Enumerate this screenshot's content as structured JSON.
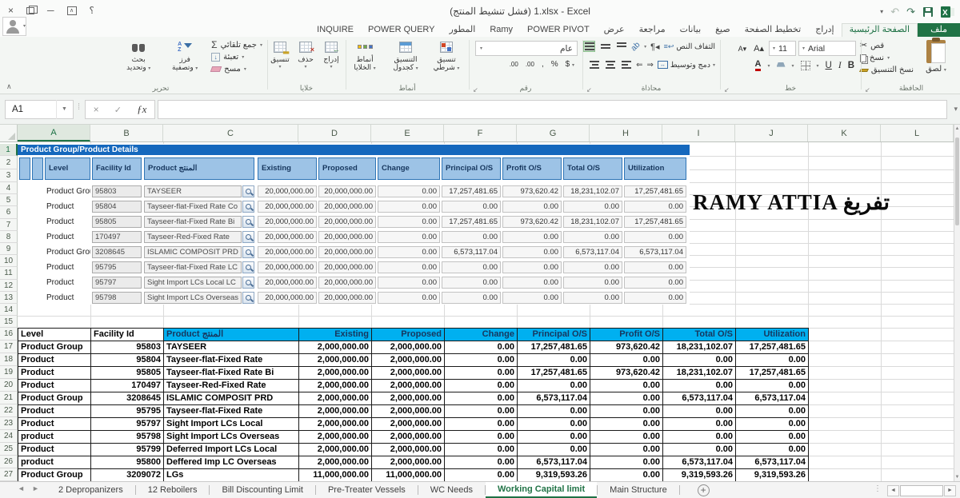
{
  "title_bar": {
    "title": "(فشل تنشيط المنتج) 1.xlsx - Excel"
  },
  "ribbon_tabs": [
    {
      "id": "file",
      "label": "ملف",
      "file": true
    },
    {
      "id": "home",
      "label": "الصفحة الرئيسية",
      "active": true
    },
    {
      "id": "insert",
      "label": "إدراج"
    },
    {
      "id": "page-layout",
      "label": "تخطيط الصفحة"
    },
    {
      "id": "formulas",
      "label": "صيغ"
    },
    {
      "id": "data",
      "label": "بيانات"
    },
    {
      "id": "review",
      "label": "مراجعة"
    },
    {
      "id": "view",
      "label": "عرض"
    },
    {
      "id": "power-pivot",
      "label": "POWER PIVOT"
    },
    {
      "id": "ramy",
      "label": "Ramy"
    },
    {
      "id": "developer",
      "label": "المطور"
    },
    {
      "id": "power-query",
      "label": "POWER QUERY"
    },
    {
      "id": "inquire",
      "label": "INQUIRE"
    }
  ],
  "ribbon": {
    "clipboard": {
      "group": "الحافظة",
      "paste": "لصق",
      "cut": "قص",
      "copy": "نسخ",
      "format_painter": "نسخ التنسيق"
    },
    "font": {
      "group": "خط",
      "name": "Arial",
      "size": "11",
      "bold": "B",
      "italic": "I",
      "underline": "U"
    },
    "alignment": {
      "group": "محاذاة",
      "wrap": "التفاف النص",
      "merge": "دمج وتوسيط"
    },
    "number": {
      "group": "رقم",
      "format": "عام",
      "currency": "$",
      "percent": "%",
      "comma": ",",
      "inc": ".00",
      "dec": ".00"
    },
    "styles": {
      "group": "أنماط",
      "conditional1": "تنسيق",
      "conditional2": "شرطي",
      "table1": "التنسيق",
      "table2": "كجدول",
      "cellstyles1": "أنماط",
      "cellstyles2": "الخلايا"
    },
    "cells": {
      "group": "خلايا",
      "insert": "إدراج",
      "delete": "حذف",
      "format": "تنسيق"
    },
    "editing": {
      "group": "تحرير",
      "autosum": "جمع تلقائي",
      "fill": "تعبئة",
      "clear": "مسح",
      "sort1": "فرز",
      "sort2": "وتصفية",
      "find1": "بحث",
      "find2": "وتحديد"
    }
  },
  "formula_bar": {
    "name_box": "A1",
    "fx": "ƒx",
    "formula": ""
  },
  "grid": {
    "columns": [
      "A",
      "B",
      "C",
      "D",
      "E",
      "F",
      "G",
      "H",
      "I",
      "J",
      "K",
      "L"
    ],
    "selected_column": "A",
    "selected_row": 1,
    "row_count": 27
  },
  "form_view": {
    "banner": "Product Group/Product Details",
    "headers": [
      "Level",
      "Facility Id",
      "Product المنتج",
      "Existing",
      "Proposed",
      "Change",
      "Principal O/S",
      "Profit O/S",
      "Total O/S",
      "Utilization"
    ],
    "records": [
      [
        "Product Group",
        "95803",
        "TAYSEER",
        "20,000,000.00",
        "20,000,000.00",
        "0.00",
        "17,257,481.65",
        "973,620.42",
        "18,231,102.07",
        "17,257,481.65"
      ],
      [
        "Product",
        "95804",
        "Tayseer-flat-Fixed Rate Co",
        "20,000,000.00",
        "20,000,000.00",
        "0.00",
        "0.00",
        "0.00",
        "0.00",
        "0.00"
      ],
      [
        "Product",
        "95805",
        "Tayseer-flat-Fixed Rate Bi",
        "20,000,000.00",
        "20,000,000.00",
        "0.00",
        "17,257,481.65",
        "973,620.42",
        "18,231,102.07",
        "17,257,481.65"
      ],
      [
        "Product",
        "170497",
        "Tayseer-Red-Fixed Rate",
        "20,000,000.00",
        "20,000,000.00",
        "0.00",
        "0.00",
        "0.00",
        "0.00",
        "0.00"
      ],
      [
        "Product Group",
        "3208645",
        "ISLAMIC COMPOSIT PRD G",
        "20,000,000.00",
        "20,000,000.00",
        "0.00",
        "6,573,117.04",
        "0.00",
        "6,573,117.04",
        "6,573,117.04"
      ],
      [
        "Product",
        "95795",
        "Tayseer-flat-Fixed Rate LC",
        "20,000,000.00",
        "20,000,000.00",
        "0.00",
        "0.00",
        "0.00",
        "0.00",
        "0.00"
      ],
      [
        "Product",
        "95797",
        "Sight Import LCs Local LC",
        "20,000,000.00",
        "20,000,000.00",
        "0.00",
        "0.00",
        "0.00",
        "0.00",
        "0.00"
      ],
      [
        "Product",
        "95798",
        "Sight Import LCs Overseas",
        "20,000,000.00",
        "20,000,000.00",
        "0.00",
        "0.00",
        "0.00",
        "0.00",
        "0.00"
      ]
    ]
  },
  "watermark": "RAMY ATTIA تفريغ",
  "sheet_table": {
    "headers": [
      "Level",
      "Facility Id",
      "Product المنتج",
      "Existing",
      "Proposed",
      "Change",
      "Principal O/S",
      "Profit O/S",
      "Total O/S",
      "Utilization"
    ],
    "rows": [
      [
        "Product Group",
        "95803",
        "TAYSEER",
        "2,000,000.00",
        "2,000,000.00",
        "0.00",
        "17,257,481.65",
        "973,620.42",
        "18,231,102.07",
        "17,257,481.65"
      ],
      [
        "Product",
        "95804",
        "Tayseer-flat-Fixed Rate",
        "2,000,000.00",
        "2,000,000.00",
        "0.00",
        "0.00",
        "0.00",
        "0.00",
        "0.00"
      ],
      [
        "Product",
        "95805",
        "Tayseer-flat-Fixed Rate Bi",
        "2,000,000.00",
        "2,000,000.00",
        "0.00",
        "17,257,481.65",
        "973,620.42",
        "18,231,102.07",
        "17,257,481.65"
      ],
      [
        "Product",
        "170497",
        "Tayseer-Red-Fixed Rate",
        "2,000,000.00",
        "2,000,000.00",
        "0.00",
        "0.00",
        "0.00",
        "0.00",
        "0.00"
      ],
      [
        "Product Group",
        "3208645",
        "ISLAMIC COMPOSIT PRD",
        "2,000,000.00",
        "2,000,000.00",
        "0.00",
        "6,573,117.04",
        "0.00",
        "6,573,117.04",
        "6,573,117.04"
      ],
      [
        "Product",
        "95795",
        "Tayseer-flat-Fixed Rate",
        "2,000,000.00",
        "2,000,000.00",
        "0.00",
        "0.00",
        "0.00",
        "0.00",
        "0.00"
      ],
      [
        "Product",
        "95797",
        "Sight Import LCs Local",
        "2,000,000.00",
        "2,000,000.00",
        "0.00",
        "0.00",
        "0.00",
        "0.00",
        "0.00"
      ],
      [
        "product",
        "95798",
        "Sight Import LCs Overseas",
        "2,000,000.00",
        "2,000,000.00",
        "0.00",
        "0.00",
        "0.00",
        "0.00",
        "0.00"
      ],
      [
        "Product",
        "95799",
        "Deferred Import LCs Local",
        "2,000,000.00",
        "2,000,000.00",
        "0.00",
        "0.00",
        "0.00",
        "0.00",
        "0.00"
      ],
      [
        "product",
        "95800",
        "Deffered Imp LC Overseas",
        "2,000,000.00",
        "2,000,000.00",
        "0.00",
        "6,573,117.04",
        "0.00",
        "6,573,117.04",
        "6,573,117.04"
      ],
      [
        "Product Group",
        "3209072",
        "LGs",
        "11,000,000.00",
        "11,000,000.00",
        "0.00",
        "9,319,593.26",
        "0.00",
        "9,319,593.26",
        "9,319,593.26"
      ]
    ]
  },
  "sheet_tabs": {
    "tabs": [
      {
        "label": "2 Depropanizers"
      },
      {
        "label": "12 Reboilers"
      },
      {
        "label": "Bill Discounting Limit"
      },
      {
        "label": "Pre-Treater Vessels"
      },
      {
        "label": "WC Needs"
      },
      {
        "label": "Working Capital limit",
        "active": true
      },
      {
        "label": "Main Structure"
      }
    ],
    "new_sheet": "+"
  },
  "colors": {
    "accent_green": "#217346",
    "banner_blue": "#1568BD",
    "form_header_blue": "#9DC3E6",
    "table_header_cyan": "#00B0F0"
  }
}
